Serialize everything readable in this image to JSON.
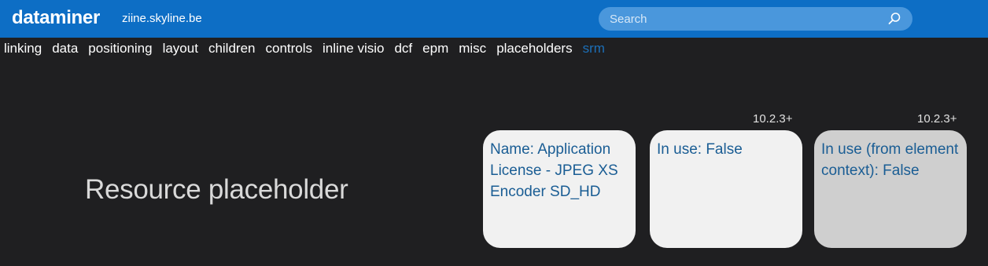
{
  "header": {
    "brand": "dataminer",
    "host": "ziine.skyline.be",
    "search_placeholder": "Search"
  },
  "nav": {
    "items": [
      {
        "label": "linking",
        "active": false
      },
      {
        "label": "data",
        "active": false
      },
      {
        "label": "positioning",
        "active": false
      },
      {
        "label": "layout",
        "active": false
      },
      {
        "label": "children",
        "active": false
      },
      {
        "label": "controls",
        "active": false
      },
      {
        "label": "inline visio",
        "active": false
      },
      {
        "label": "dcf",
        "active": false
      },
      {
        "label": "epm",
        "active": false
      },
      {
        "label": "misc",
        "active": false
      },
      {
        "label": "placeholders",
        "active": false
      },
      {
        "label": "srm",
        "active": true
      }
    ]
  },
  "main": {
    "title": "Resource placeholder",
    "cards": [
      {
        "text": "Name: Application License - JPEG XS Encoder SD_HD",
        "version": ""
      },
      {
        "text": "In use: False",
        "version": "10.2.3+"
      },
      {
        "text": "In use (from element context): False",
        "version": "10.2.3+"
      }
    ]
  },
  "colors": {
    "header_bg": "#0d6ec5",
    "page_bg": "#1f1f21",
    "active_tab": "#1c6fb8",
    "card_text": "#1a5d94"
  }
}
